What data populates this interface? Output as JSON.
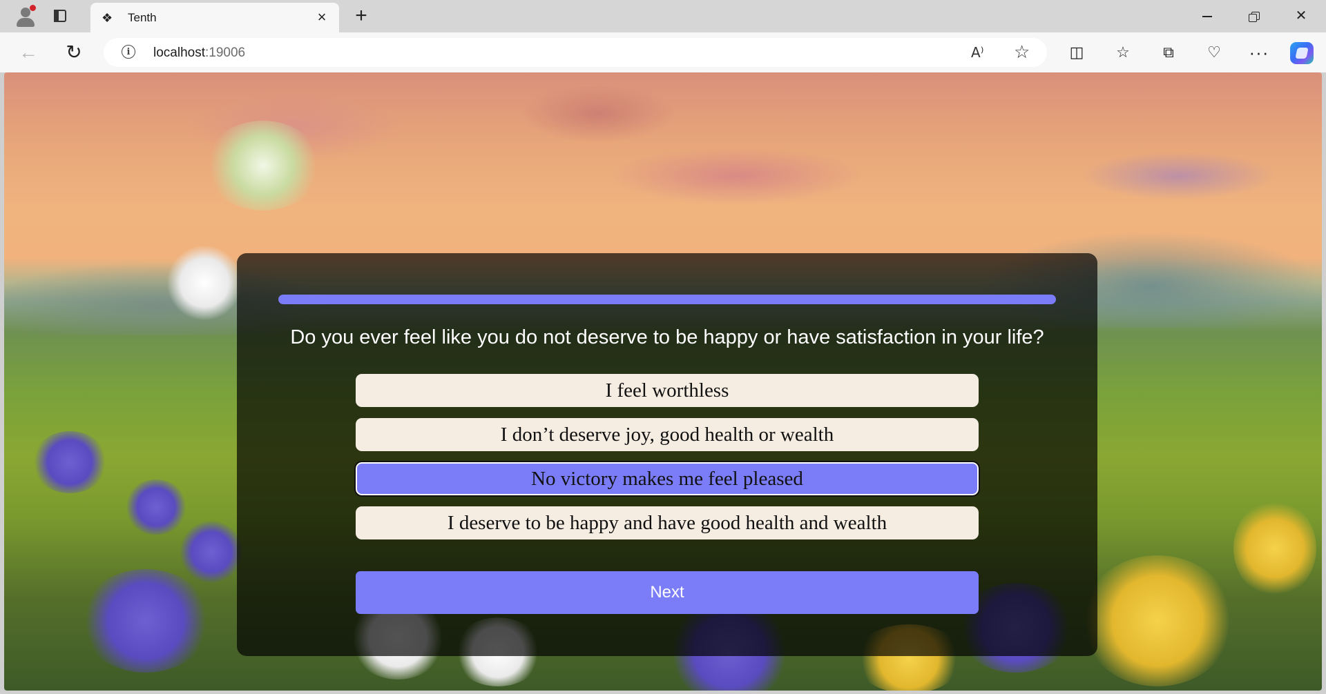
{
  "browser": {
    "tab_title": "Tenth",
    "tab_favicon": "puzzle-icon",
    "url_host": "localhost",
    "url_port": ":19006",
    "new_tab_symbol": "+",
    "close_tab_symbol": "×",
    "icons": {
      "profile": "profile-icon",
      "tab_actions": "tab-actions-icon",
      "back": "back-arrow-icon",
      "reload": "reload-icon",
      "site_info": "info-icon",
      "read_aloud": "read-aloud-icon",
      "favorite": "star-icon",
      "split_screen": "split-screen-icon",
      "favorites": "favorites-icon",
      "collections": "collections-icon",
      "browser_essentials": "heart-pulse-icon",
      "more": "more-icon",
      "copilot": "copilot-icon"
    }
  },
  "quiz": {
    "progress": 1.0,
    "question": "Do you ever feel like you do not deserve to be happy or have satisfaction in your life?",
    "options": [
      {
        "label": "I feel worthless",
        "selected": false
      },
      {
        "label": "I don’t deserve joy, good health or wealth",
        "selected": false
      },
      {
        "label": "No victory makes me feel pleased",
        "selected": true
      },
      {
        "label": "I deserve to be happy and have good health and wealth",
        "selected": false
      }
    ],
    "next_label": "Next"
  },
  "colors": {
    "accent": "#7b7df8",
    "option_bg": "#f5ece2",
    "card_overlay": "rgba(0,0,0,0.68)"
  }
}
